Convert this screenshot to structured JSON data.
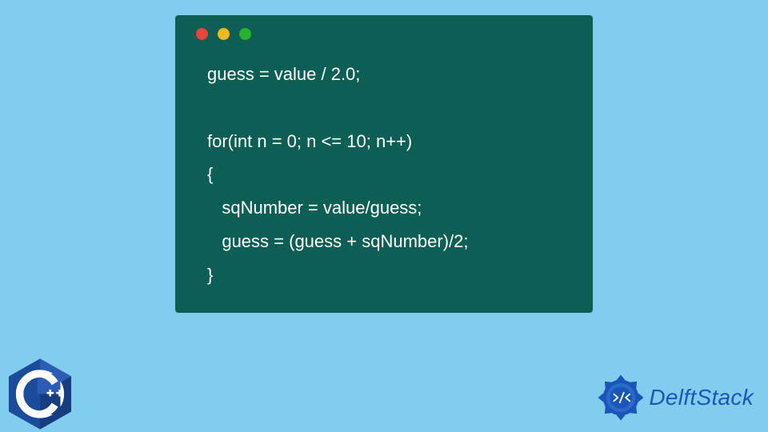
{
  "code": {
    "line1": "guess = value / 2.0;",
    "blank": "",
    "line2": "for(int n = 0; n <= 10; n++)",
    "line3": "{",
    "line4": "   sqNumber = value/guess;",
    "line5": "   guess = (guess + sqNumber)/2;",
    "line6": "}"
  },
  "window": {
    "bg_color": "#0d5f56",
    "dot_red": "#ed4240",
    "dot_yellow": "#f2b91e",
    "dot_green": "#29b32a"
  },
  "cpp_logo": {
    "label": "C++",
    "color": "#1b4b9b"
  },
  "brand": {
    "name": "DelftStack",
    "color": "#1a56b9"
  }
}
